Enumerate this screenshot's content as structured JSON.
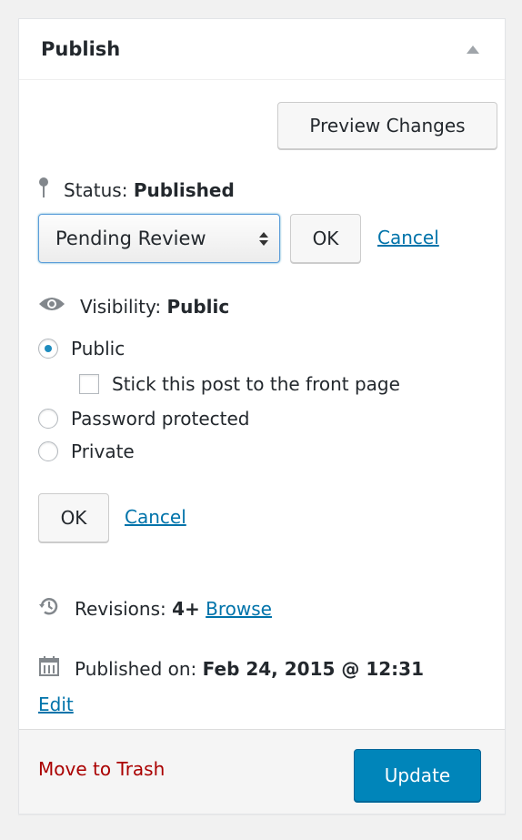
{
  "panel": {
    "title": "Publish"
  },
  "actions": {
    "preview_label": "Preview Changes"
  },
  "status": {
    "label": "Status:",
    "value": "Published",
    "select_value": "Pending Review",
    "ok_label": "OK",
    "cancel_label": "Cancel"
  },
  "visibility": {
    "label": "Visibility:",
    "value": "Public",
    "options": [
      {
        "label": "Public",
        "checked": true
      },
      {
        "label": "Password protected",
        "checked": false
      },
      {
        "label": "Private",
        "checked": false
      }
    ],
    "sticky_label": "Stick this post to the front page",
    "ok_label": "OK",
    "cancel_label": "Cancel"
  },
  "revisions": {
    "label": "Revisions:",
    "value": "4+",
    "browse_label": "Browse"
  },
  "published": {
    "label": "Published on:",
    "value": "Feb 24, 2015 @ 12:31",
    "edit_label": "Edit"
  },
  "footer": {
    "trash_label": "Move to Trash",
    "update_label": "Update"
  },
  "colors": {
    "accent": "#0085ba",
    "link": "#0073aa",
    "danger": "#aa0000"
  }
}
